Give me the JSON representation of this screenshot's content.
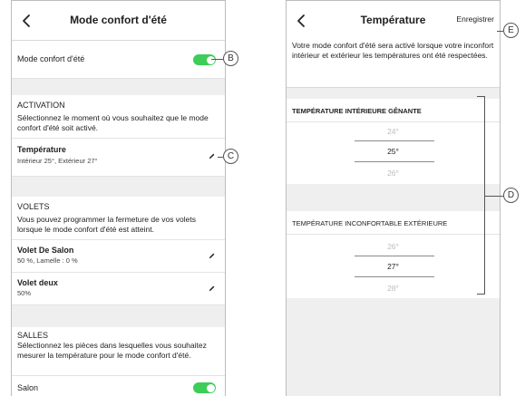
{
  "left_screen": {
    "title": "Mode confort d'été",
    "mode_toggle_label": "Mode confort d'été",
    "activation": {
      "header": "ACTIVATION",
      "description": "Sélectionnez le moment où vous souhaitez que le mode confort d'été soit activé.",
      "temperature_title": "Température",
      "temperature_subtitle": "Intérieur 25°, Extérieur 27°"
    },
    "volets": {
      "header": "VOLETS",
      "description": "Vous pouvez programmer la fermeture de vos volets lorsque le mode confort d'été est atteint.",
      "items": [
        {
          "title": "Volet De Salon",
          "subtitle": "50 %, Lamelle : 0 %"
        },
        {
          "title": "Volet deux",
          "subtitle": "50%"
        }
      ]
    },
    "salles": {
      "header": "SALLES",
      "description": "Sélectionnez les pièces dans lesquelles vous souhaitez mesurer la température pour le mode confort d'été.",
      "rooms": [
        {
          "label": "Salon",
          "on": true
        }
      ]
    }
  },
  "right_screen": {
    "title": "Température",
    "save_label": "Enregistrer",
    "description": "Votre mode confort d'été sera activé lorsque votre inconfort intérieur et extérieur les températures ont été respectées.",
    "indoor": {
      "header": "TEMPÉRATURE INTÉRIEURE GÊNANTE",
      "values": [
        "24°",
        "25°",
        "26°"
      ],
      "selected": "25°"
    },
    "outdoor": {
      "header": "TEMPÉRATURE INCONFORTABLE EXTÉRIEURE",
      "values": [
        "26°",
        "27°",
        "28°"
      ],
      "selected": "27°"
    }
  },
  "callouts": {
    "b": "B",
    "c": "C",
    "d": "D",
    "e": "E"
  },
  "colors": {
    "toggle_on": "#3dcd58",
    "section_gap": "#efefef",
    "faded_text": "#bcbcbc"
  },
  "icons": {
    "back": "chevron-left-icon",
    "edit": "pencil-icon"
  }
}
